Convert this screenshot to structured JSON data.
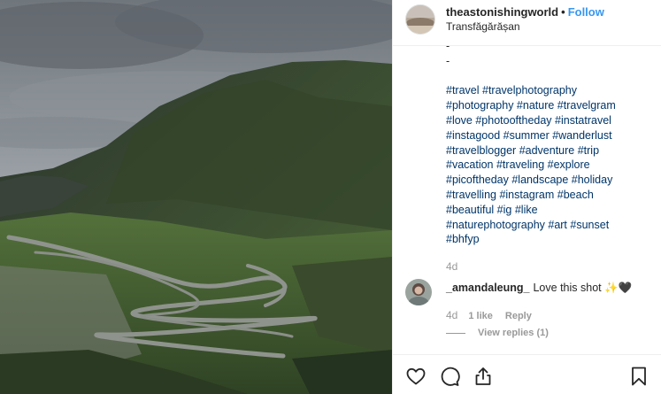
{
  "header": {
    "username": "theastonishingworld",
    "separator": "•",
    "follow_label": "Follow",
    "location": "Transfăgărășan"
  },
  "caption": {
    "lines": [
      "-",
      "-",
      "",
      "#travel #travelphotography",
      "#photography #nature #travelgram",
      "#love #photooftheday #instatravel",
      "#instagood #summer #wanderlust",
      "#travelblogger #adventure #trip",
      "#vacation #traveling #explore",
      "#picoftheday #landscape #holiday",
      "#travelling #instagram #beach",
      "#beautiful #ig #like",
      "#naturephotography #art #sunset",
      "#bhfyp"
    ],
    "timestamp": "4d"
  },
  "comment": {
    "username": "_amandaleung_",
    "text": "Love this shot ✨🖤",
    "timestamp": "4d",
    "likes_label": "1 like",
    "reply_label": "Reply",
    "view_replies_label": "View replies (1)"
  },
  "actions": {
    "icons": [
      "heart-icon",
      "comment-icon",
      "share-icon",
      "bookmark-icon"
    ]
  },
  "colors": {
    "link_blue": "#3897f0",
    "hashtag": "#003569",
    "muted": "#999999"
  }
}
